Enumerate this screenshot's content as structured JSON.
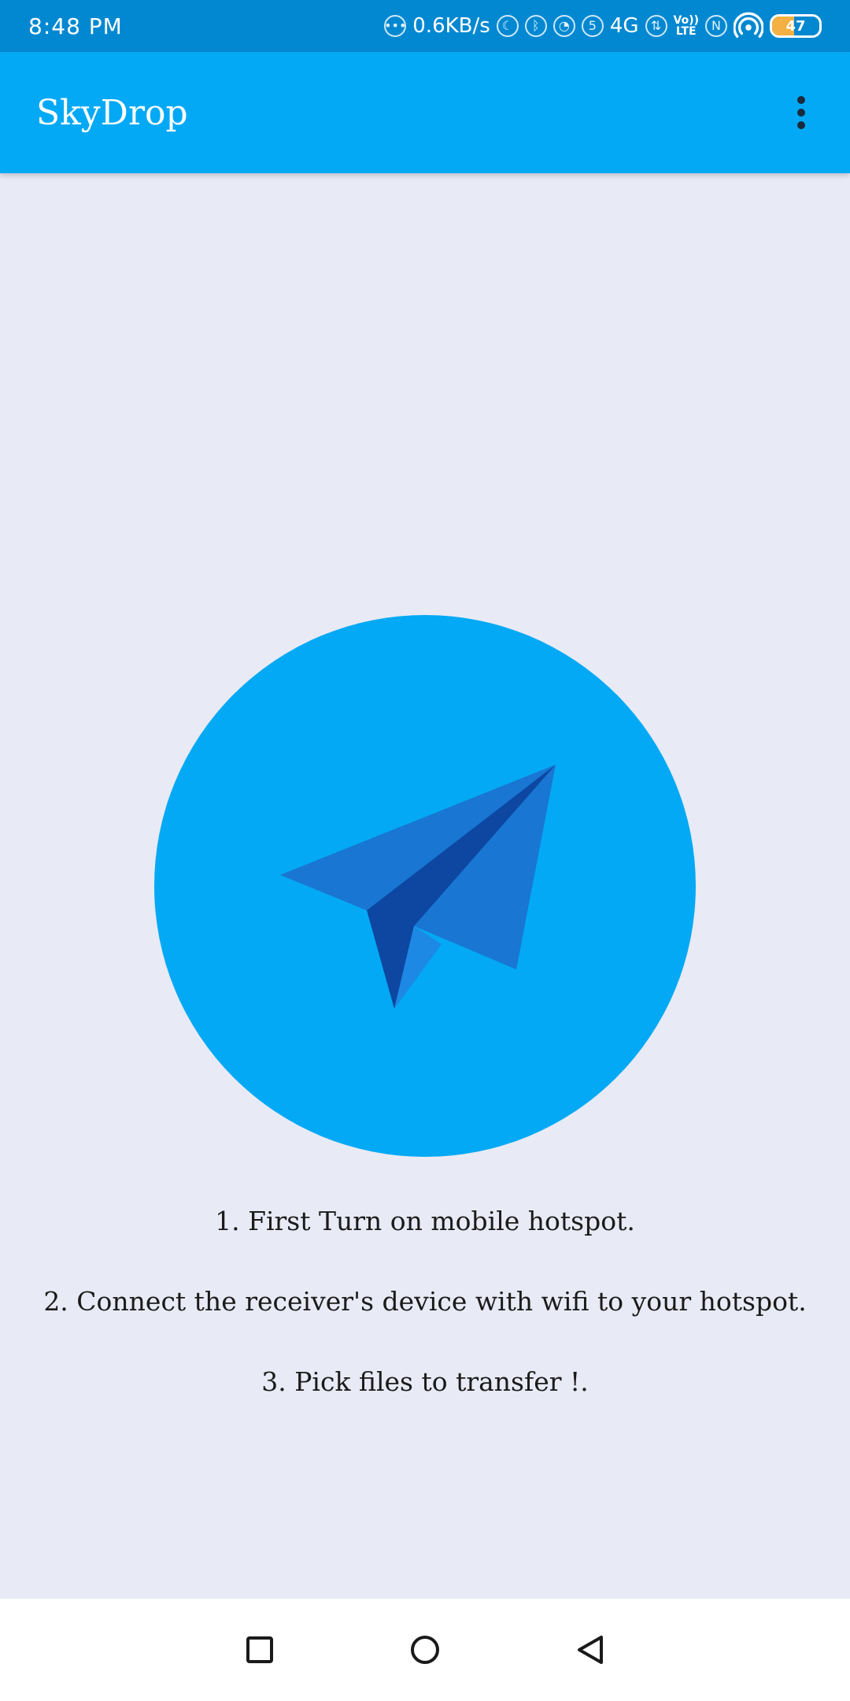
{
  "status_bar": {
    "time": "8:48 PM",
    "net_speed": "0.6KB/s",
    "sim_slot": "5",
    "network_type": "4G",
    "volte_line1": "Vo))",
    "volte_line2": "LTE",
    "battery_level": 47,
    "battery_label": "47",
    "battery_color": "#f4b042",
    "icons": [
      "more-dots-icon",
      "moon-icon",
      "bluetooth-icon",
      "alarm-icon",
      "sim-icon",
      "data-arrows-icon",
      "nfc-icon",
      "hotspot-icon",
      "battery-icon"
    ]
  },
  "app_bar": {
    "title": "SkyDrop",
    "menu_icon": "more-vert-icon",
    "color": "#03a9f4"
  },
  "main": {
    "send_button_icon": "paper-plane-icon",
    "accent_color": "#03a9f4",
    "instructions": [
      "1. First Turn on mobile hotspot.",
      "2. Connect the receiver's device with wifi to your hotspot.",
      "3. Pick files to transfer !."
    ]
  },
  "nav_bar": {
    "buttons": [
      "recents-square-icon",
      "home-circle-icon",
      "back-triangle-icon"
    ]
  }
}
